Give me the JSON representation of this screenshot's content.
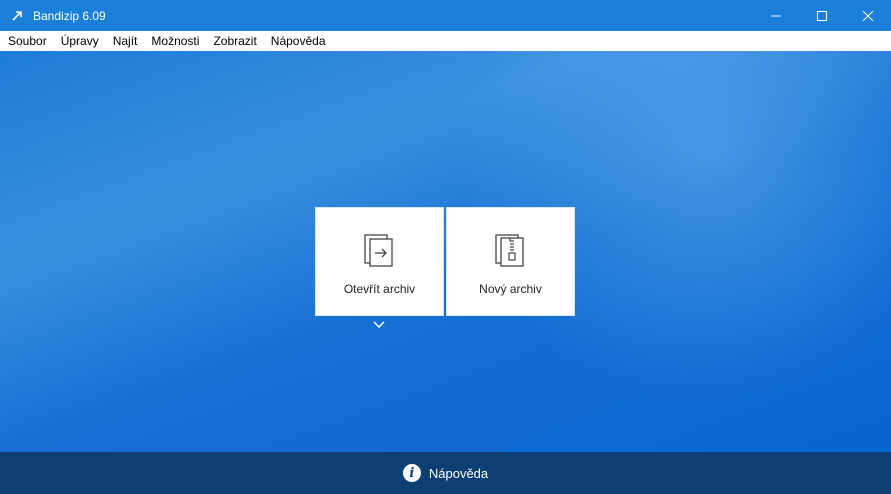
{
  "window": {
    "title": "Bandizip 6.09"
  },
  "menu": {
    "items": [
      "Soubor",
      "Úpravy",
      "Najít",
      "Možnosti",
      "Zobrazit",
      "Nápověda"
    ]
  },
  "tiles": {
    "open_label": "Otevřít archiv",
    "new_label": "Nový archiv"
  },
  "footer": {
    "help_label": "Nápověda",
    "help_glyph": "i"
  },
  "colors": {
    "titlebar": "#1a7fd8",
    "background": "#0a6fd6",
    "footer": "#0d3f73"
  },
  "icons": [
    "app-icon",
    "minimize-icon",
    "maximize-icon",
    "close-icon",
    "open-archive-icon",
    "new-archive-icon",
    "chevron-down-icon",
    "info-icon"
  ]
}
